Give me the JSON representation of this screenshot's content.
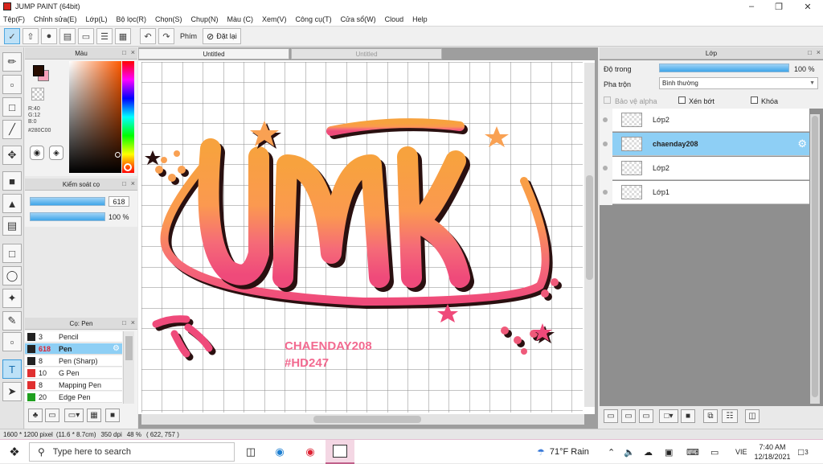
{
  "window": {
    "title": "JUMP PAINT (64bit)"
  },
  "menu": [
    "Tệp(F)",
    "Chỉnh sửa(E)",
    "Lớp(L)",
    "Bộ lọc(R)",
    "Chọn(S)",
    "Chụp(N)",
    "Màu (C)",
    "Xem(V)",
    "Công cụ(T)",
    "Cửa sổ(W)",
    "Cloud",
    "Help"
  ],
  "toolbar": {
    "phim_label": "Phím",
    "reset_label": "Đặt lại"
  },
  "color_panel": {
    "title": "Màu",
    "main_color": "#280C00",
    "sub_color": "#f8a0b8",
    "r": "R:40",
    "g": "G:12",
    "b": "B:0",
    "hex": "#280C00"
  },
  "brush_control": {
    "title": "Kiểm soát cọ",
    "size_value": "618",
    "opacity_value": "100 %"
  },
  "pen_panel": {
    "title": "Cọ: Pen",
    "items": [
      {
        "size": "3",
        "name": "Pencil",
        "color": "#222222"
      },
      {
        "size": "618",
        "name": "Pen",
        "color": "#222222"
      },
      {
        "size": "8",
        "name": "Pen (Sharp)",
        "color": "#222222"
      },
      {
        "size": "10",
        "name": "G Pen",
        "color": "#e03030"
      },
      {
        "size": "8",
        "name": "Mapping Pen",
        "color": "#e03030"
      },
      {
        "size": "20",
        "name": "Edge Pen",
        "color": "#20a020"
      }
    ]
  },
  "tabs": {
    "active": "Untitled",
    "inactive": "Untitled"
  },
  "canvas_text": {
    "big_letters": "JMK",
    "line1": "CHAENDAY208",
    "line2": "#HD247"
  },
  "layer_panel": {
    "title": "Lớp",
    "opacity_label": "Độ trong",
    "opacity_value": "100 %",
    "blend_label": "Pha trộn",
    "blend_value": "Bình thường",
    "protect_alpha": "Bảo vệ alpha",
    "clipping": "Xén bớt",
    "lock": "Khóa",
    "layers": [
      {
        "name": "Lớp2",
        "selected": false
      },
      {
        "name": "chaenday208",
        "selected": true
      },
      {
        "name": "Lớp2",
        "selected": false
      },
      {
        "name": "Lớp1",
        "selected": false
      }
    ]
  },
  "status": {
    "size": "1600 * 1200 pixel",
    "cm": "(11.6 * 8.7cm)",
    "dpi": "350 dpi",
    "zoom": "48 %",
    "coords": "( 622, 757 )"
  },
  "taskbar": {
    "search_placeholder": "Type here to search",
    "weather": "71°F  Rain",
    "lang": "VIE",
    "time": "7:40 AM",
    "date": "12/18/2021",
    "notif": "3"
  }
}
